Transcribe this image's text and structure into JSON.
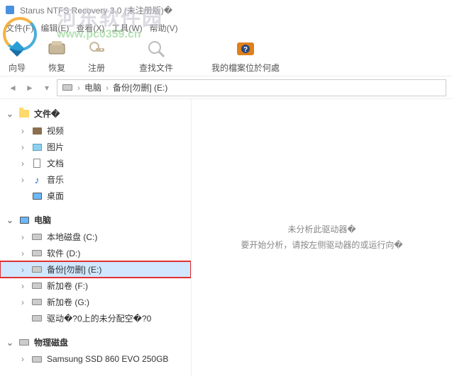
{
  "window": {
    "title": "Starus NTFS Recovery 3.0 (未注册版)�"
  },
  "menu": {
    "file": "文件(F)",
    "edit": "编辑(E)",
    "view": "查看(X)",
    "tools": "工具(W)",
    "help": "帮助(V)"
  },
  "toolbar": {
    "wizard": "向导",
    "recover": "恢复",
    "register": "注册",
    "find": "查找文件",
    "where": "我的檔案位於何處"
  },
  "breadcrumb": {
    "root": "电脑",
    "current": "备份[勿删] (E:)"
  },
  "tree": {
    "files_header": "文件�",
    "files": {
      "video": "视频",
      "pictures": "图片",
      "documents": "文档",
      "music": "音乐",
      "desktop": "桌面"
    },
    "computer_header": "电脑",
    "drives": {
      "c": "本地磁盘 (C:)",
      "d": "软件 (D:)",
      "e": "备份[勿删] (E:)",
      "f": "新加卷 (F:)",
      "g": "新加卷 (G:)",
      "unalloc": "驱动�?0上的未分配空�?0"
    },
    "physical_header": "物理磁盘",
    "physical": {
      "ssd": "Samsung SSD 860 EVO 250GB"
    }
  },
  "content": {
    "line1": "未分析此驱动器�",
    "line2": "要开始分析，请按左侧驱动器的或运行向�"
  },
  "watermark": {
    "line1": "河东软件园",
    "line2": "www.pc0359.cn"
  }
}
